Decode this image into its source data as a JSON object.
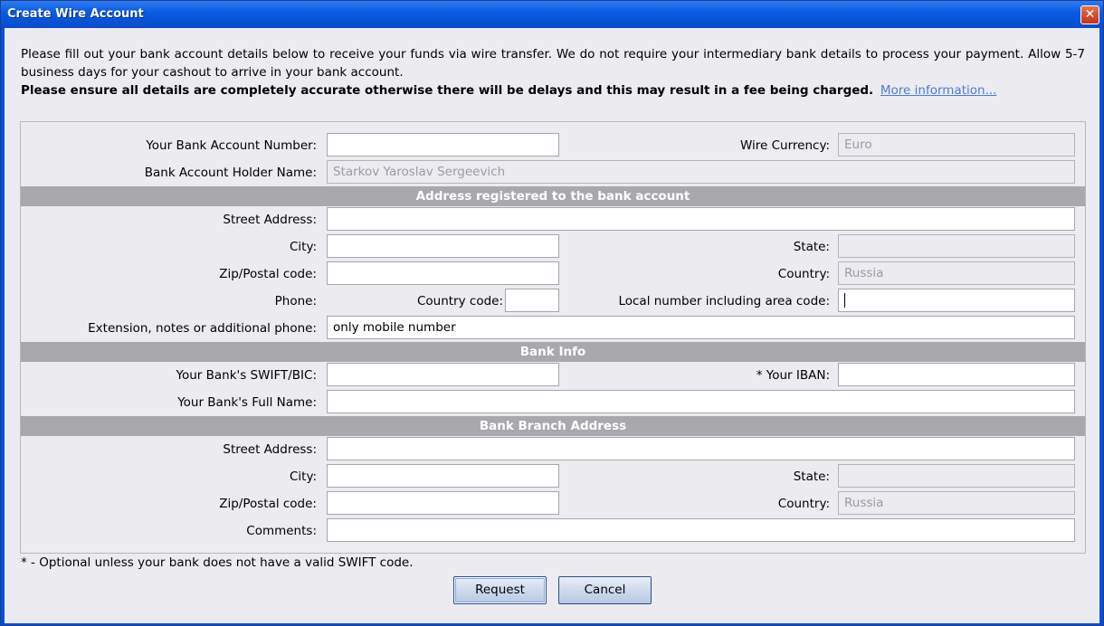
{
  "window": {
    "title": "Create Wire Account",
    "close_glyph": "✕"
  },
  "intro": {
    "text": "Please fill out your bank account details below to receive your funds via wire transfer. We do not require your intermediary bank details to process your payment. Allow 5-7 business days for your cashout to arrive in your bank account.",
    "warning": "Please ensure all details are completely accurate otherwise there will be delays and this may result in a fee being charged.",
    "link": "More information..."
  },
  "account": {
    "number_label": "Your Bank Account Number:",
    "number_value": "",
    "currency_label": "Wire Currency:",
    "currency_value": "Euro",
    "holder_label": "Bank Account Holder Name:",
    "holder_value": "Starkov Yaroslav Sergeevich"
  },
  "address": {
    "header": "Address registered to the bank account",
    "street_label": "Street Address:",
    "street_value": "",
    "city_label": "City:",
    "city_value": "",
    "state_label": "State:",
    "state_value": "",
    "zip_label": "Zip/Postal code:",
    "zip_value": "",
    "country_label": "Country:",
    "country_value": "Russia",
    "phone_label": "Phone:",
    "country_code_label": "Country code:",
    "country_code_value": "",
    "local_label": "Local number including area code:",
    "local_value": "",
    "ext_label": "Extension, notes or additional phone:",
    "ext_value": "only mobile number"
  },
  "bank": {
    "header": "Bank Info",
    "swift_label": "Your Bank's SWIFT/BIC:",
    "swift_value": "",
    "iban_label": "* Your IBAN:",
    "iban_value": "",
    "name_label": "Your Bank's Full Name:",
    "name_value": ""
  },
  "branch": {
    "header": "Bank Branch Address",
    "street_label": "Street Address:",
    "street_value": "",
    "city_label": "City:",
    "city_value": "",
    "state_label": "State:",
    "state_value": "",
    "zip_label": "Zip/Postal code:",
    "zip_value": "",
    "country_label": "Country:",
    "country_value": "Russia",
    "comments_label": "Comments:",
    "comments_value": ""
  },
  "footnote": "* - Optional unless your bank does not have a valid SWIFT code.",
  "buttons": {
    "request": "Request",
    "cancel": "Cancel"
  }
}
